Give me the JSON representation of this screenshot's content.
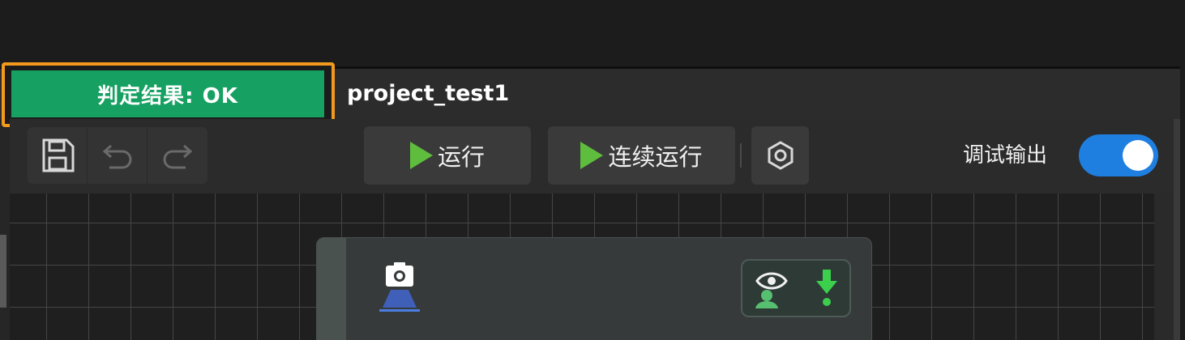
{
  "result_badge": {
    "text": "判定结果: OK",
    "color": "#16a062",
    "highlight_color": "#f39a1e"
  },
  "project": {
    "title": "project_test1"
  },
  "toolbar": {
    "file_group": [
      {
        "name": "save",
        "icon": "save-icon"
      },
      {
        "name": "undo",
        "icon": "undo-icon"
      },
      {
        "name": "redo",
        "icon": "redo-icon"
      }
    ],
    "run_label": "运行",
    "run_loop_label": "连续运行",
    "settings_icon": "hexagon-settings-icon",
    "debug_output_label": "调试输出",
    "debug_output_enabled": true,
    "toggle_color": "#1f7fe0"
  },
  "node": {
    "icon": "camera-icon",
    "actions": [
      {
        "name": "visibility",
        "icon": "eye-user-icon"
      },
      {
        "name": "output",
        "icon": "download-arrow-icon"
      }
    ]
  }
}
